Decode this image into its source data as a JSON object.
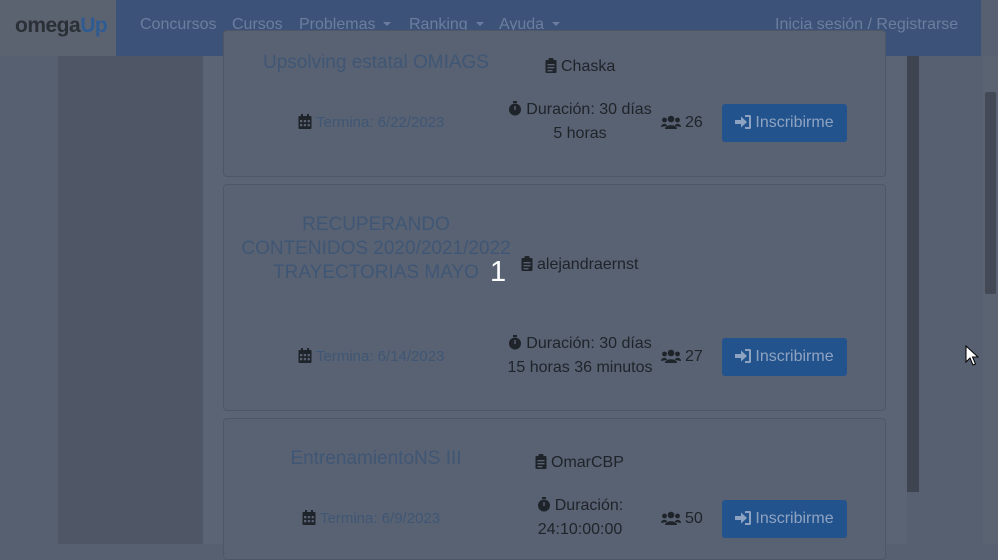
{
  "brand": {
    "part1": "omega",
    "part2": "Up"
  },
  "nav": {
    "items": [
      {
        "label": "Concursos"
      },
      {
        "label": "Cursos"
      },
      {
        "label": "Problemas"
      },
      {
        "label": "Ranking"
      },
      {
        "label": "Ayuda"
      }
    ],
    "login": "Inicia sesión / Registrarse"
  },
  "contests": [
    {
      "title": "Upsolving estatal OMIAGS",
      "owner": "Chaska",
      "ends": "Termina: 6/22/2023",
      "duration_line1": "Duración: 30 días",
      "duration_line2": "5 horas",
      "participants": "26",
      "button": "Inscribirme"
    },
    {
      "title": "RECUPERANDO CONTENIDOS 2020/2021/2022 TRAYECTORIAS MAYO",
      "owner": "alejandraernst",
      "ends": "Termina: 6/14/2023",
      "duration_line1": "Duración: 30 días",
      "duration_line2": "15 horas 36 minutos",
      "participants": "27",
      "button": "Inscribirme"
    },
    {
      "title": "EntrenamientoNS III",
      "owner": "OmarCBP",
      "ends": "Termina: 6/9/2023",
      "duration_line1": "Duración:",
      "duration_line2": "24:10:00:00",
      "participants": "50",
      "button": "Inscribirme"
    }
  ],
  "overlay_number": "1",
  "colors": {
    "navbar": "#3d5278",
    "button": "#23538c",
    "brand_accent": "#2f5b93"
  }
}
